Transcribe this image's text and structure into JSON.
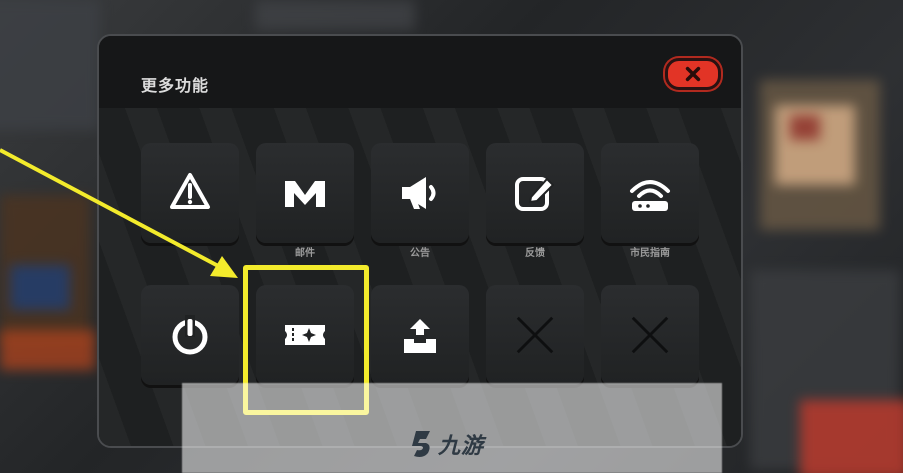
{
  "dialog": {
    "title": "更多功能",
    "close_icon": "close-x-icon"
  },
  "tiles": [
    {
      "id": "tile-1",
      "label": "",
      "icon": "warning-triangle-icon"
    },
    {
      "id": "tile-2",
      "label": "邮件",
      "icon": "mail-m-icon"
    },
    {
      "id": "tile-3",
      "label": "公告",
      "icon": "megaphone-icon"
    },
    {
      "id": "tile-4",
      "label": "反馈",
      "icon": "edit-square-icon"
    },
    {
      "id": "tile-5",
      "label": "市民指南",
      "icon": "wifi-guide-icon"
    },
    {
      "id": "tile-6",
      "label": "",
      "icon": "power-icon"
    },
    {
      "id": "tile-7",
      "label": "",
      "icon": "ticket-star-icon"
    },
    {
      "id": "tile-8",
      "label": "",
      "icon": "upload-box-icon"
    },
    {
      "id": "tile-9",
      "label": "",
      "icon": "disabled-x-icon"
    },
    {
      "id": "tile-10",
      "label": "",
      "icon": "disabled-x-icon"
    }
  ],
  "watermark": {
    "text": "九游"
  },
  "colors": {
    "highlight": "#f3eb2c",
    "close_button": "#e23426"
  }
}
